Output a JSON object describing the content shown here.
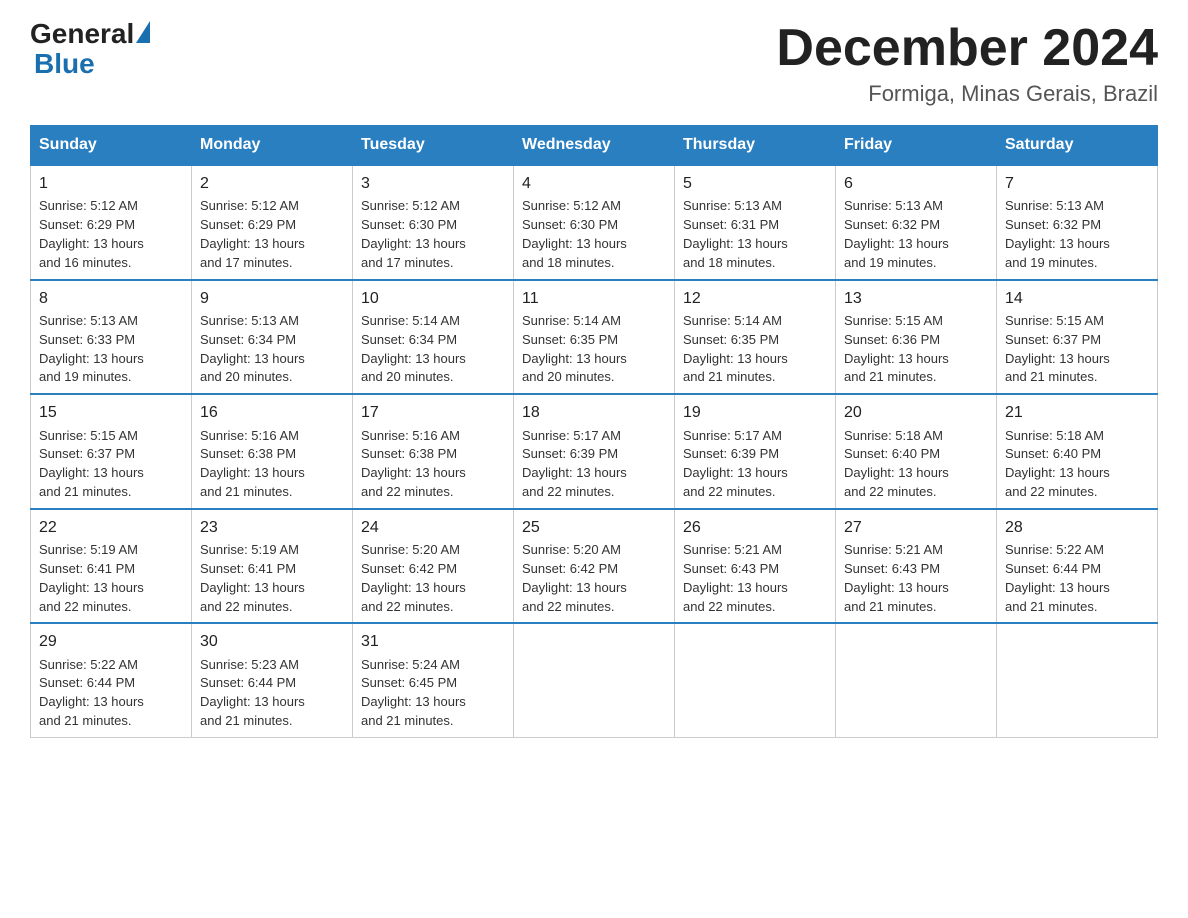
{
  "logo": {
    "general": "General",
    "blue": "Blue"
  },
  "title": "December 2024",
  "subtitle": "Formiga, Minas Gerais, Brazil",
  "days_of_week": [
    "Sunday",
    "Monday",
    "Tuesday",
    "Wednesday",
    "Thursday",
    "Friday",
    "Saturday"
  ],
  "weeks": [
    [
      {
        "day": "1",
        "sunrise": "5:12 AM",
        "sunset": "6:29 PM",
        "daylight": "13 hours and 16 minutes."
      },
      {
        "day": "2",
        "sunrise": "5:12 AM",
        "sunset": "6:29 PM",
        "daylight": "13 hours and 17 minutes."
      },
      {
        "day": "3",
        "sunrise": "5:12 AM",
        "sunset": "6:30 PM",
        "daylight": "13 hours and 17 minutes."
      },
      {
        "day": "4",
        "sunrise": "5:12 AM",
        "sunset": "6:30 PM",
        "daylight": "13 hours and 18 minutes."
      },
      {
        "day": "5",
        "sunrise": "5:13 AM",
        "sunset": "6:31 PM",
        "daylight": "13 hours and 18 minutes."
      },
      {
        "day": "6",
        "sunrise": "5:13 AM",
        "sunset": "6:32 PM",
        "daylight": "13 hours and 19 minutes."
      },
      {
        "day": "7",
        "sunrise": "5:13 AM",
        "sunset": "6:32 PM",
        "daylight": "13 hours and 19 minutes."
      }
    ],
    [
      {
        "day": "8",
        "sunrise": "5:13 AM",
        "sunset": "6:33 PM",
        "daylight": "13 hours and 19 minutes."
      },
      {
        "day": "9",
        "sunrise": "5:13 AM",
        "sunset": "6:34 PM",
        "daylight": "13 hours and 20 minutes."
      },
      {
        "day": "10",
        "sunrise": "5:14 AM",
        "sunset": "6:34 PM",
        "daylight": "13 hours and 20 minutes."
      },
      {
        "day": "11",
        "sunrise": "5:14 AM",
        "sunset": "6:35 PM",
        "daylight": "13 hours and 20 minutes."
      },
      {
        "day": "12",
        "sunrise": "5:14 AM",
        "sunset": "6:35 PM",
        "daylight": "13 hours and 21 minutes."
      },
      {
        "day": "13",
        "sunrise": "5:15 AM",
        "sunset": "6:36 PM",
        "daylight": "13 hours and 21 minutes."
      },
      {
        "day": "14",
        "sunrise": "5:15 AM",
        "sunset": "6:37 PM",
        "daylight": "13 hours and 21 minutes."
      }
    ],
    [
      {
        "day": "15",
        "sunrise": "5:15 AM",
        "sunset": "6:37 PM",
        "daylight": "13 hours and 21 minutes."
      },
      {
        "day": "16",
        "sunrise": "5:16 AM",
        "sunset": "6:38 PM",
        "daylight": "13 hours and 21 minutes."
      },
      {
        "day": "17",
        "sunrise": "5:16 AM",
        "sunset": "6:38 PM",
        "daylight": "13 hours and 22 minutes."
      },
      {
        "day": "18",
        "sunrise": "5:17 AM",
        "sunset": "6:39 PM",
        "daylight": "13 hours and 22 minutes."
      },
      {
        "day": "19",
        "sunrise": "5:17 AM",
        "sunset": "6:39 PM",
        "daylight": "13 hours and 22 minutes."
      },
      {
        "day": "20",
        "sunrise": "5:18 AM",
        "sunset": "6:40 PM",
        "daylight": "13 hours and 22 minutes."
      },
      {
        "day": "21",
        "sunrise": "5:18 AM",
        "sunset": "6:40 PM",
        "daylight": "13 hours and 22 minutes."
      }
    ],
    [
      {
        "day": "22",
        "sunrise": "5:19 AM",
        "sunset": "6:41 PM",
        "daylight": "13 hours and 22 minutes."
      },
      {
        "day": "23",
        "sunrise": "5:19 AM",
        "sunset": "6:41 PM",
        "daylight": "13 hours and 22 minutes."
      },
      {
        "day": "24",
        "sunrise": "5:20 AM",
        "sunset": "6:42 PM",
        "daylight": "13 hours and 22 minutes."
      },
      {
        "day": "25",
        "sunrise": "5:20 AM",
        "sunset": "6:42 PM",
        "daylight": "13 hours and 22 minutes."
      },
      {
        "day": "26",
        "sunrise": "5:21 AM",
        "sunset": "6:43 PM",
        "daylight": "13 hours and 22 minutes."
      },
      {
        "day": "27",
        "sunrise": "5:21 AM",
        "sunset": "6:43 PM",
        "daylight": "13 hours and 21 minutes."
      },
      {
        "day": "28",
        "sunrise": "5:22 AM",
        "sunset": "6:44 PM",
        "daylight": "13 hours and 21 minutes."
      }
    ],
    [
      {
        "day": "29",
        "sunrise": "5:22 AM",
        "sunset": "6:44 PM",
        "daylight": "13 hours and 21 minutes."
      },
      {
        "day": "30",
        "sunrise": "5:23 AM",
        "sunset": "6:44 PM",
        "daylight": "13 hours and 21 minutes."
      },
      {
        "day": "31",
        "sunrise": "5:24 AM",
        "sunset": "6:45 PM",
        "daylight": "13 hours and 21 minutes."
      },
      null,
      null,
      null,
      null
    ]
  ],
  "labels": {
    "sunrise": "Sunrise:",
    "sunset": "Sunset:",
    "daylight": "Daylight:"
  }
}
